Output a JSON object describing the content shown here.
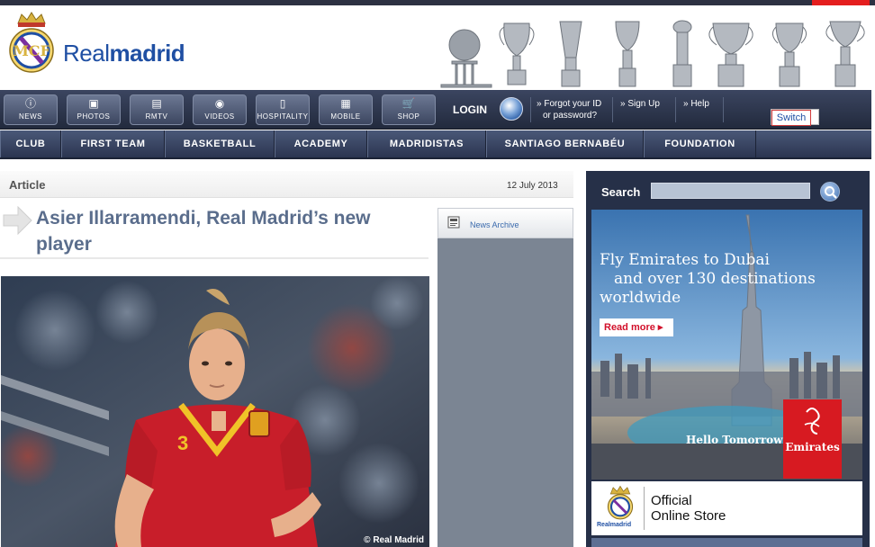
{
  "brand": {
    "name_light": "Real",
    "name_bold": "madrid"
  },
  "main_nav": [
    {
      "label": "NEWS",
      "icon": "info-icon"
    },
    {
      "label": "PHOTOS",
      "icon": "photo-icon"
    },
    {
      "label": "RMTV",
      "icon": "tv-icon"
    },
    {
      "label": "VIDEOS",
      "icon": "video-icon"
    },
    {
      "label": "HOSPITALITY",
      "icon": "hospitality-icon"
    },
    {
      "label": "MOBILE",
      "icon": "mobile-icon"
    },
    {
      "label": "SHOP",
      "icon": "cart-icon"
    }
  ],
  "account": {
    "login": "LOGIN",
    "forgot_line1": "» Forgot your ID",
    "forgot_line2": "or password?",
    "signup": "» Sign Up",
    "help": "» Help",
    "switch": "Switch"
  },
  "section_nav": [
    "CLUB",
    "FIRST TEAM",
    "BASKETBALL",
    "ACADEMY",
    "MADRIDISTAS",
    "SANTIAGO BERNABÉU",
    "FOUNDATION"
  ],
  "article": {
    "section_label": "Article",
    "date": "12 July 2013",
    "title": "Asier Illarramendi, Real Madrid’s new player",
    "photo_credit": "© Real Madrid"
  },
  "sidebar": {
    "news_archive": "News Archive"
  },
  "search": {
    "label": "Search",
    "value": ""
  },
  "ad": {
    "line1": "Fly Emirates to Dubai",
    "line2": "and over 130 destinations",
    "line3": "worldwide",
    "cta": "Read more ▸",
    "tagline": "Hello Tomorrow",
    "brand": "Emirates"
  },
  "store": {
    "line1": "Official",
    "line2": "Online Store",
    "brand": "Realmadrid"
  },
  "colors": {
    "brand_blue": "#1f4fa3",
    "nav_dark": "#263048",
    "accent_red": "#d71a21",
    "title_blue": "#5a6d8c"
  }
}
